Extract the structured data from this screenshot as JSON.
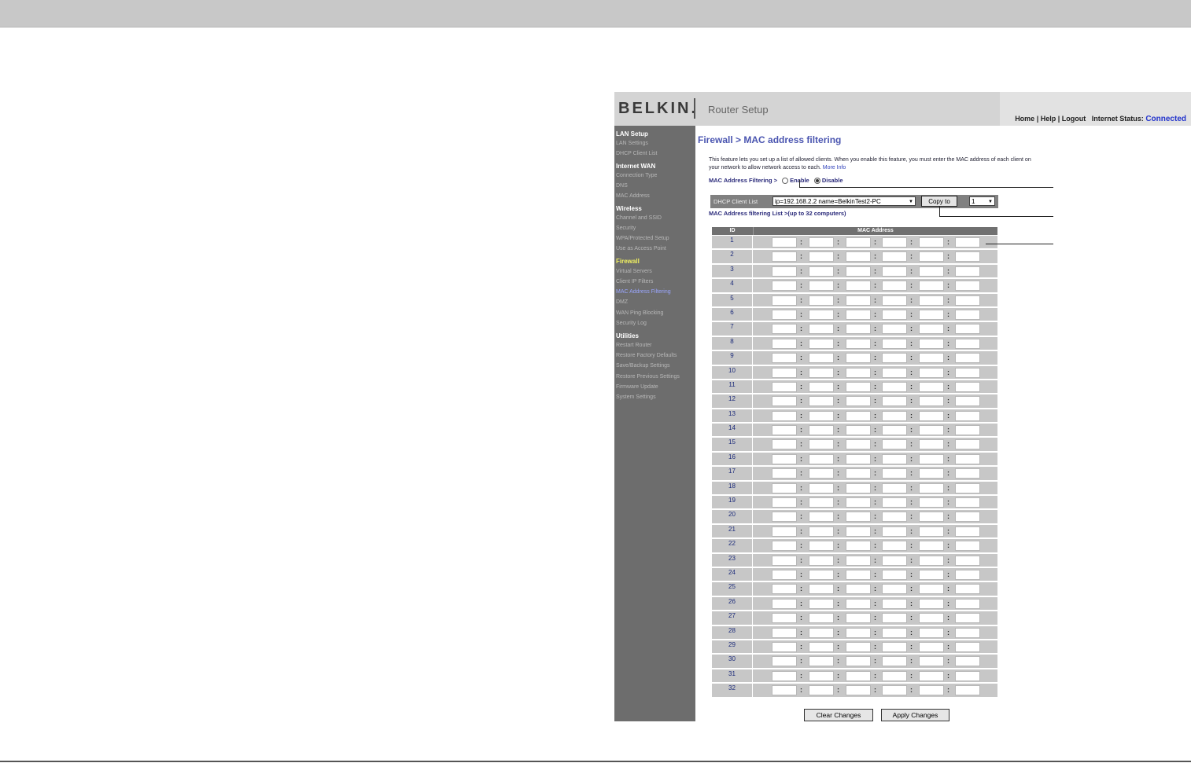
{
  "header": {
    "logo": "BELKIN.",
    "title": "Router Setup",
    "links": [
      "Home",
      "Help",
      "Logout"
    ],
    "status_label": "Internet Status:",
    "status_value": "Connected"
  },
  "sidebar": {
    "items": [
      {
        "label": "LAN Setup",
        "kind": "head"
      },
      {
        "label": "LAN Settings",
        "kind": "item"
      },
      {
        "label": "DHCP Client List",
        "kind": "item"
      },
      {
        "label": "Internet WAN",
        "kind": "head"
      },
      {
        "label": "Connection Type",
        "kind": "item"
      },
      {
        "label": "DNS",
        "kind": "item"
      },
      {
        "label": "MAC Address",
        "kind": "item"
      },
      {
        "label": "Wireless",
        "kind": "head"
      },
      {
        "label": "Channel and SSID",
        "kind": "item"
      },
      {
        "label": "Security",
        "kind": "item"
      },
      {
        "label": "WPA/Protected Setup",
        "kind": "item"
      },
      {
        "label": "Use as Access Point",
        "kind": "item"
      },
      {
        "label": "Firewall",
        "kind": "active"
      },
      {
        "label": "Virtual Servers",
        "kind": "item"
      },
      {
        "label": "Client IP Filters",
        "kind": "item"
      },
      {
        "label": "MAC Address Filtering",
        "kind": "current"
      },
      {
        "label": "DMZ",
        "kind": "item"
      },
      {
        "label": "WAN Ping Blocking",
        "kind": "item"
      },
      {
        "label": "Security Log",
        "kind": "item"
      },
      {
        "label": "Utilities",
        "kind": "head"
      },
      {
        "label": "Restart Router",
        "kind": "item"
      },
      {
        "label": "Restore Factory Defaults",
        "kind": "item"
      },
      {
        "label": "Save/Backup Settings",
        "kind": "item"
      },
      {
        "label": "Restore Previous Settings",
        "kind": "item"
      },
      {
        "label": "Firmware Update",
        "kind": "item"
      },
      {
        "label": "System Settings",
        "kind": "item"
      }
    ]
  },
  "main": {
    "breadcrumb": "Firewall > MAC address filtering",
    "description": "This feature lets you set up a list of allowed clients. When you enable this feature, you must enter the MAC address of each client on your network to allow network access to each.",
    "more_info": "More Info",
    "filtering_label": "MAC Address Filtering >",
    "enable_label": "Enable",
    "disable_label": "Disable",
    "selected": "Disable",
    "dhcp_label": "DHCP Client List",
    "dhcp_value": "ip=192.168.2.2 name=BelkinTest2-PC",
    "copy_button": "Copy to",
    "copy_target": "1",
    "list_caption": "MAC Address filtering List >(up to 32 computers)",
    "table": {
      "col_id": "ID",
      "col_mac": "MAC Address",
      "row_count": 32
    },
    "clear_button": "Clear Changes",
    "apply_button": "Apply Changes"
  }
}
